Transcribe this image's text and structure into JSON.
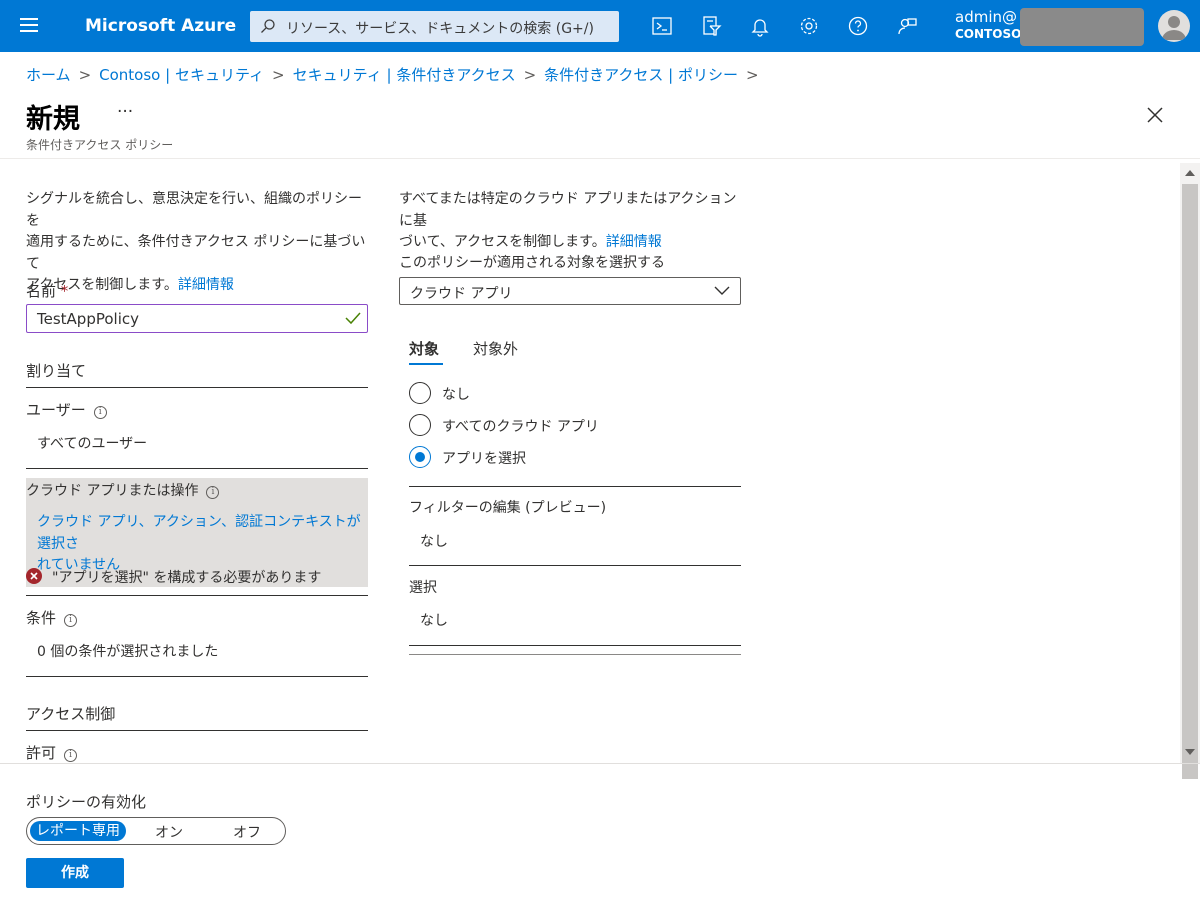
{
  "topbar": {
    "brand": "Microsoft Azure",
    "search_placeholder": "リソース、サービス、ドキュメントの検索 (G+/)",
    "account_name": "admin@",
    "account_org": "CONTOSO",
    "icons": [
      "cloud-shell-icon",
      "directory-filter-icon",
      "bell-icon",
      "gear-icon",
      "help-icon",
      "feedback-icon"
    ]
  },
  "breadcrumb": [
    "ホーム",
    "Contoso | セキュリティ",
    "セキュリティ | 条件付きアクセス",
    "条件付きアクセス | ポリシー"
  ],
  "header": {
    "title": "新規",
    "more": "···",
    "subtitle": "条件付きアクセス ポリシー"
  },
  "left": {
    "desc_line1": "シグナルを統合し、意思決定を行い、組織のポリシーを",
    "desc_line2": "適用するために、条件付きアクセス ポリシーに基づいて",
    "desc_line3": "アクセスを制御します。",
    "learn_more": "詳細情報",
    "name_label": "名前",
    "required_mark": "*",
    "name_value": "TestAppPolicy",
    "assignments_heading": "割り当て",
    "users_label": "ユーザー",
    "users_value": "すべてのユーザー",
    "cloud_apps_label": "クラウド アプリまたは操作",
    "cloud_apps_value_line1": "クラウド アプリ、アクション、認証コンテキストが選択さ",
    "cloud_apps_value_line2": "れていません",
    "error_text": "\"アプリを選択\" を構成する必要があります",
    "conditions_label": "条件",
    "conditions_value": "0 個の条件が選択されました",
    "access_controls_heading": "アクセス制御",
    "grant_label": "許可"
  },
  "right": {
    "desc_line1": "すべてまたは特定のクラウド アプリまたはアクションに基",
    "desc_line2": "づいて、アクセスを制御します。",
    "learn_more": "詳細情報",
    "select_label": "このポリシーが適用される対象を選択する",
    "select_value": "クラウド アプリ",
    "tabs": [
      {
        "label": "対象",
        "active": true
      },
      {
        "label": "対象外",
        "active": false
      }
    ],
    "radios": [
      {
        "label": "なし",
        "checked": false
      },
      {
        "label": "すべてのクラウド アプリ",
        "checked": false
      },
      {
        "label": "アプリを選択",
        "checked": true
      }
    ],
    "filter_label": "フィルターの編集 (プレビュー)",
    "filter_value": "なし",
    "select_section_label": "選択",
    "select_section_value": "なし"
  },
  "footer": {
    "enable_label": "ポリシーの有効化",
    "toggle_options": [
      "レポート専用",
      "オン",
      "オフ"
    ],
    "toggle_selected": "レポート専用",
    "create_label": "作成"
  },
  "colors": {
    "accent": "#0078d4",
    "error": "#a4262c",
    "topbar": "#0078d4"
  }
}
